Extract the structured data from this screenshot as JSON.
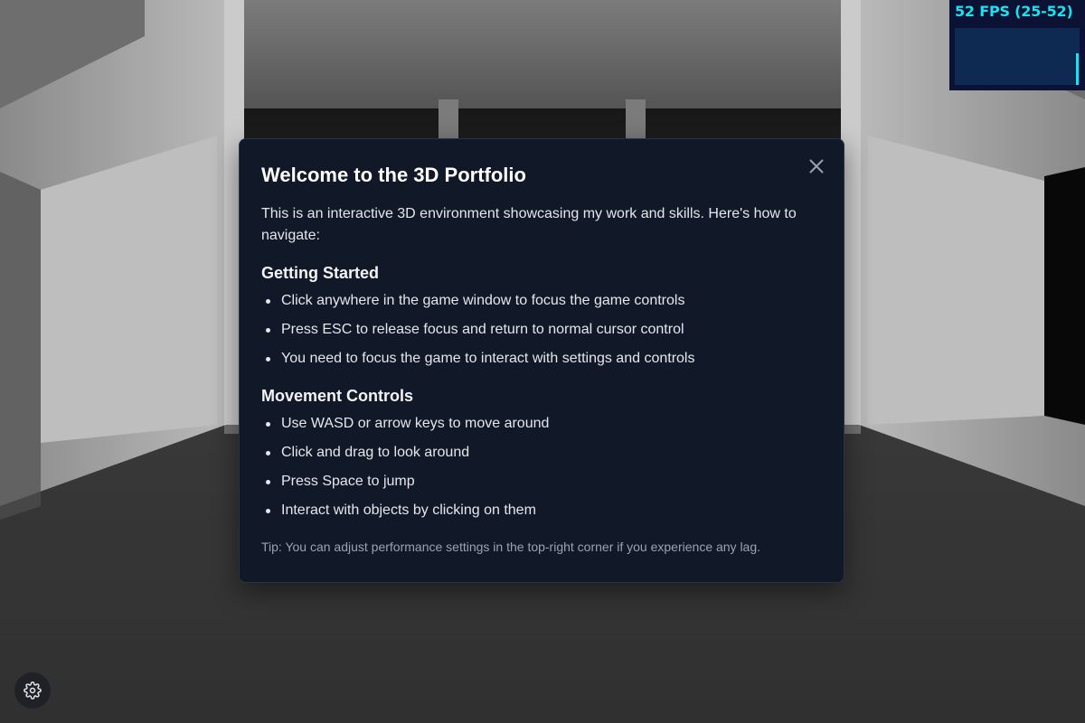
{
  "fps_monitor": {
    "readout": "52 FPS (25-52)",
    "current_fps": 52,
    "min_fps": 25,
    "max_fps": 52
  },
  "modal": {
    "title": "Welcome to the 3D Portfolio",
    "intro": "This is an interactive 3D environment showcasing my work and skills. Here's how to navigate:",
    "sections": [
      {
        "heading": "Getting Started",
        "items": [
          "Click anywhere in the game window to focus the game controls",
          "Press ESC to release focus and return to normal cursor control",
          "You need to focus the game to interact with settings and controls"
        ]
      },
      {
        "heading": "Movement Controls",
        "items": [
          "Use WASD or arrow keys to move around",
          "Click and drag to look around",
          "Press Space to jump",
          "Interact with objects by clicking on them"
        ]
      }
    ],
    "tip": "Tip: You can adjust performance settings in the top-right corner if you experience any lag.",
    "close_icon": "close-icon"
  },
  "settings": {
    "icon": "gear-icon"
  },
  "colors": {
    "modal_bg": "#111827",
    "fps_accent": "#19e3f0",
    "fps_bg": "#0b1233"
  }
}
